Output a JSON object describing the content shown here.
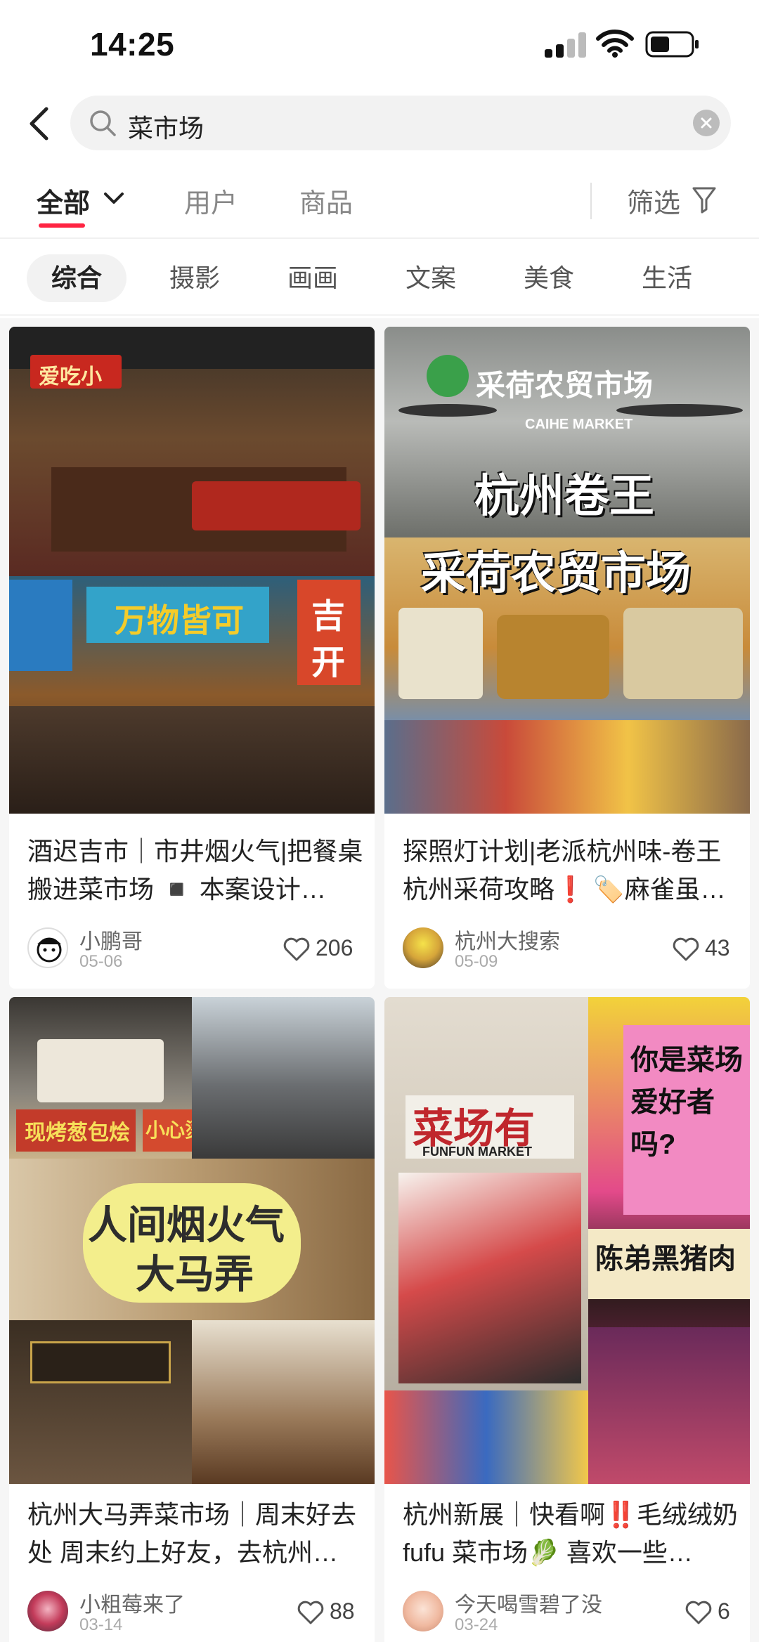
{
  "status_bar": {
    "time": "14:25"
  },
  "search": {
    "query": "菜市场"
  },
  "tabs": [
    {
      "label": "全部"
    },
    {
      "label": "用户"
    },
    {
      "label": "商品"
    }
  ],
  "filter_label": "筛选",
  "chips": [
    "综合",
    "摄影",
    "画画",
    "文案",
    "美食",
    "生活"
  ],
  "cards": [
    {
      "title": "酒迟吉市｜市井烟火气|把餐桌搬进菜市场 ◾️ 本案设计…",
      "author": "小鹏哥",
      "date": "05-06",
      "likes": "206",
      "image_texts": [
        "爱吃小",
        "万物皆可",
        "吉",
        "开"
      ]
    },
    {
      "title": "探照灯计划|老派杭州味-卷王杭州采荷攻略❗️ 🏷️麻雀虽…",
      "author": "杭州大搜索",
      "date": "05-09",
      "likes": "43",
      "image_texts": [
        "采荷农贸市场",
        "CAIHE MARKET",
        "杭州卷王",
        "采荷农贸市场"
      ]
    },
    {
      "title": "杭州大马弄菜市场｜周末好去处 周末约上好友，去杭州…",
      "author": "小粗莓来了",
      "date": "03-14",
      "likes": "88",
      "image_texts": [
        "人间烟火气",
        "大马弄",
        "现烤葱包烩",
        "小心烫"
      ]
    },
    {
      "title": "杭州新展｜快看啊‼️毛绒绒奶 fufu 菜市场🥬 喜欢一些…",
      "author": "今天喝雪碧了没",
      "date": "03-24",
      "likes": "6",
      "image_texts": [
        "菜场有",
        "FUNFUN MARKET",
        "你是菜场爱好者吗?",
        "陈弟黑猪肉"
      ]
    }
  ],
  "colors": {
    "accent": "#ff2442",
    "background": "#f6f6f6"
  }
}
